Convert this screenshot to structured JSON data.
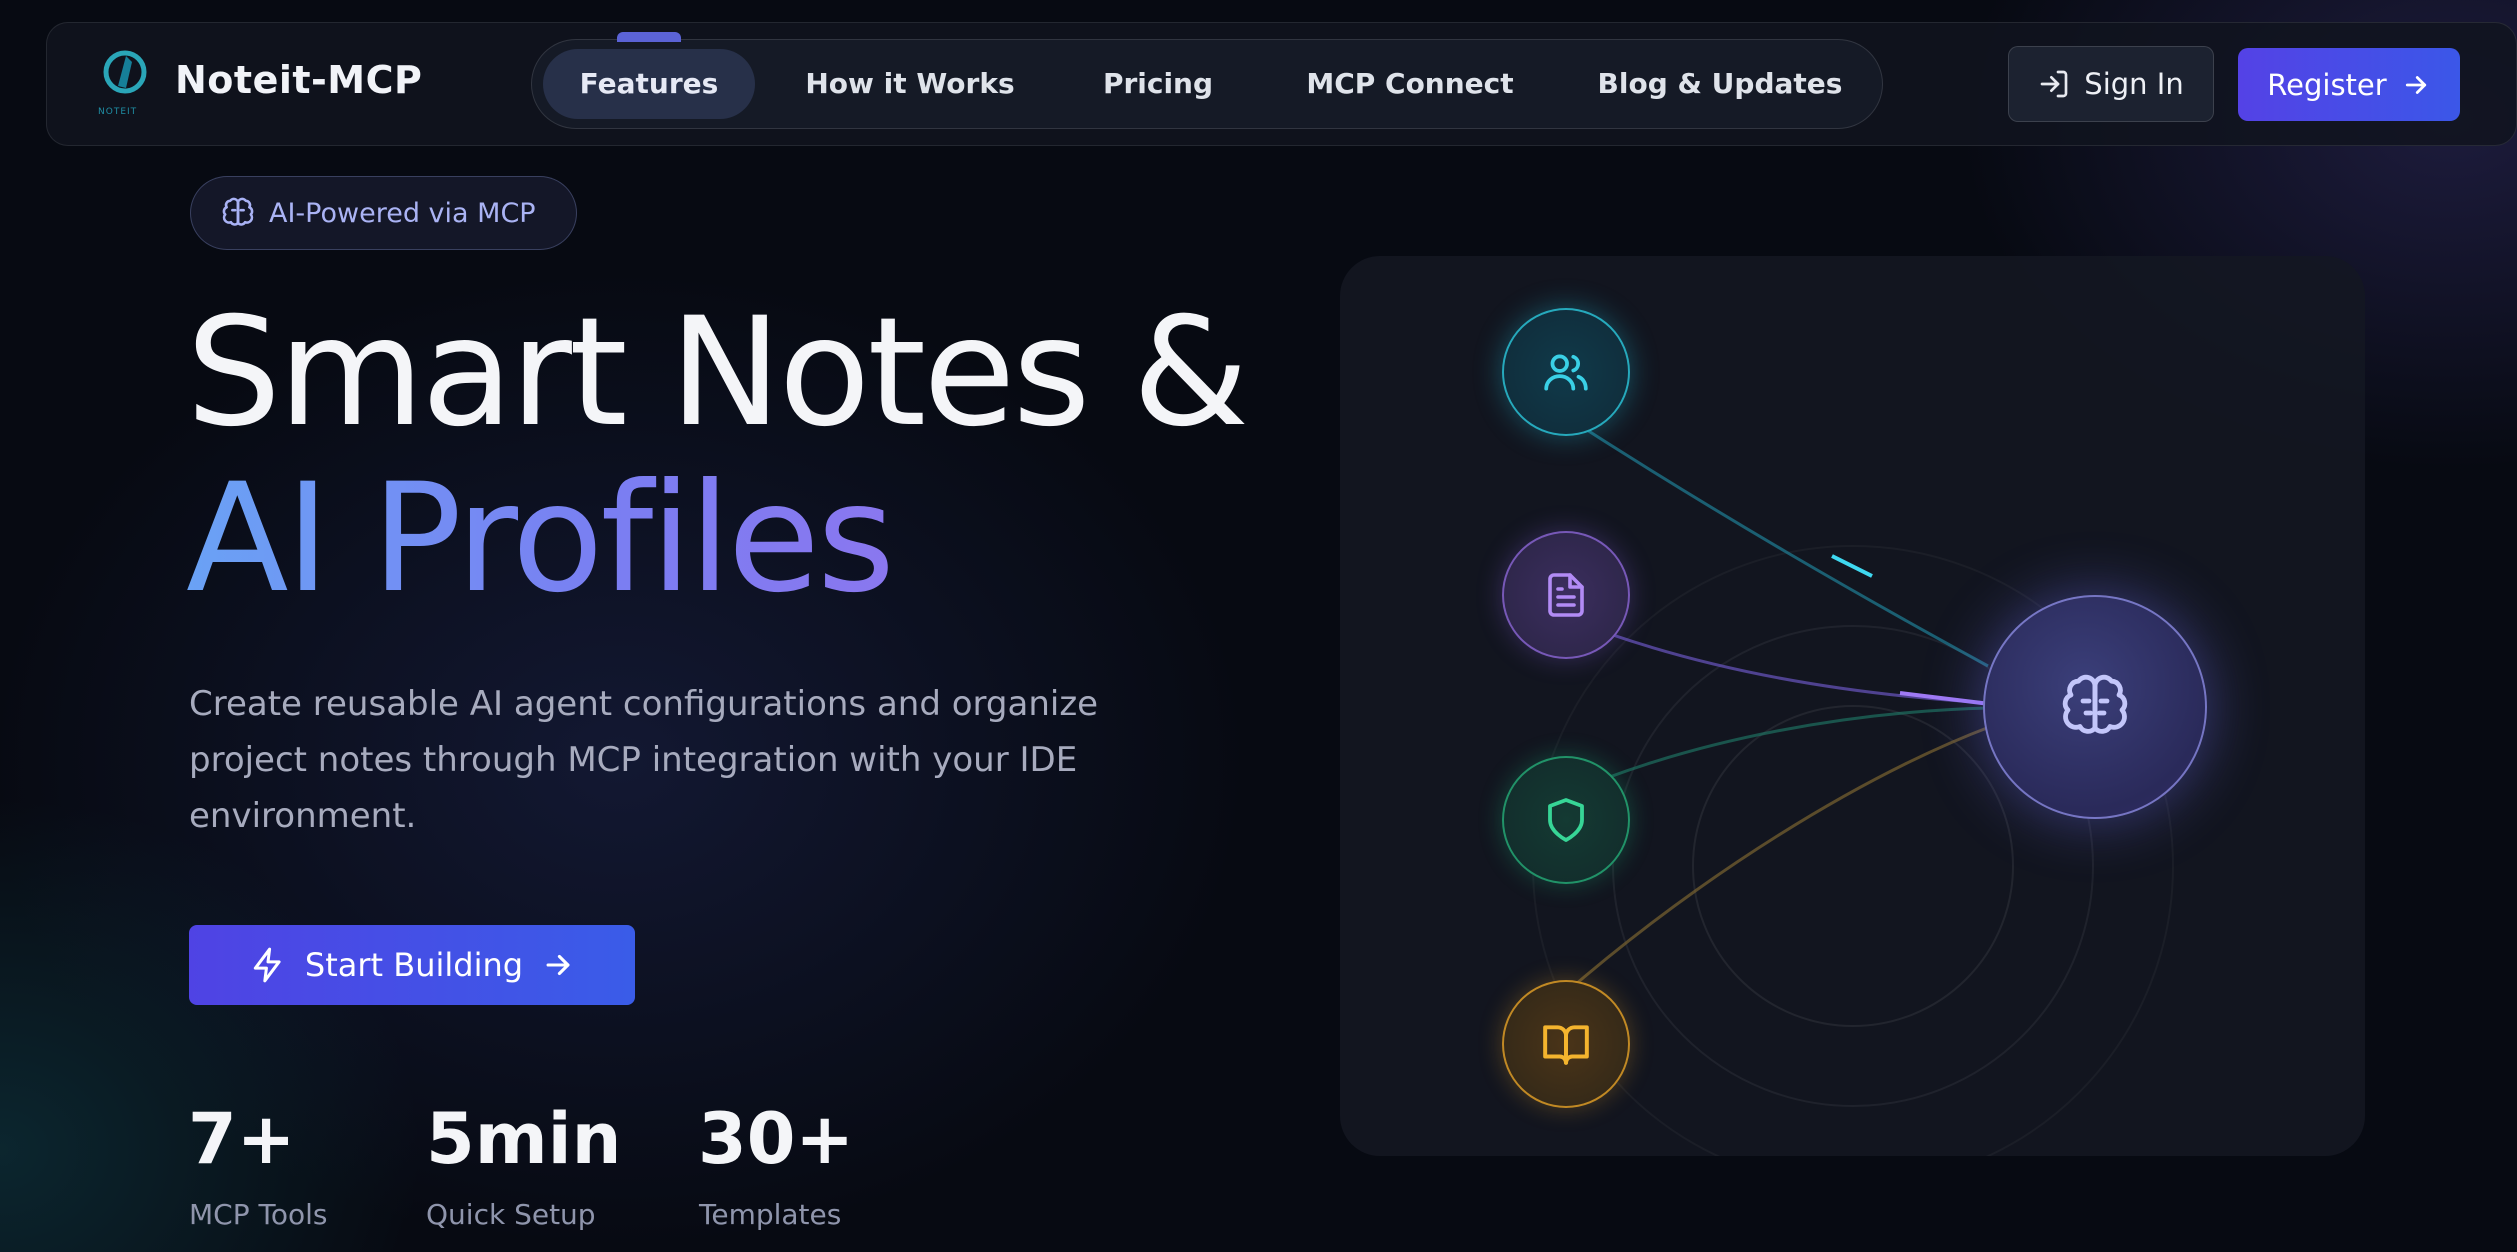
{
  "brand": {
    "name": "Noteit-MCP",
    "logo_text": "NOTEIT"
  },
  "nav": {
    "items": [
      {
        "label": "Features",
        "active": true
      },
      {
        "label": "How it Works"
      },
      {
        "label": "Pricing"
      },
      {
        "label": "MCP Connect"
      },
      {
        "label": "Blog & Updates"
      }
    ]
  },
  "auth": {
    "signin_label": "Sign In",
    "register_label": "Register"
  },
  "hero": {
    "badge": "AI-Powered via MCP",
    "title_line1": "Smart Notes &",
    "title_line2": "AI Profiles",
    "description": "Create reusable AI agent configurations and organize project notes through MCP integration with your IDE environment.",
    "cta_label": "Start Building"
  },
  "stats": [
    {
      "value": "7+",
      "label": "MCP Tools"
    },
    {
      "value": "5min",
      "label": "Quick Setup"
    },
    {
      "value": "30+",
      "label": "Templates"
    }
  ],
  "diagram": {
    "nodes": [
      "users-icon",
      "document-icon",
      "shield-icon",
      "book-icon"
    ],
    "hub": "brain-icon",
    "colors": {
      "users": "#22c3dc",
      "document": "#9a72e8",
      "shield": "#2cc48a",
      "book": "#f0ab2a",
      "hub": "#8d8ff0"
    }
  },
  "colors": {
    "accent": "#4f46e5",
    "background": "#070a12"
  }
}
